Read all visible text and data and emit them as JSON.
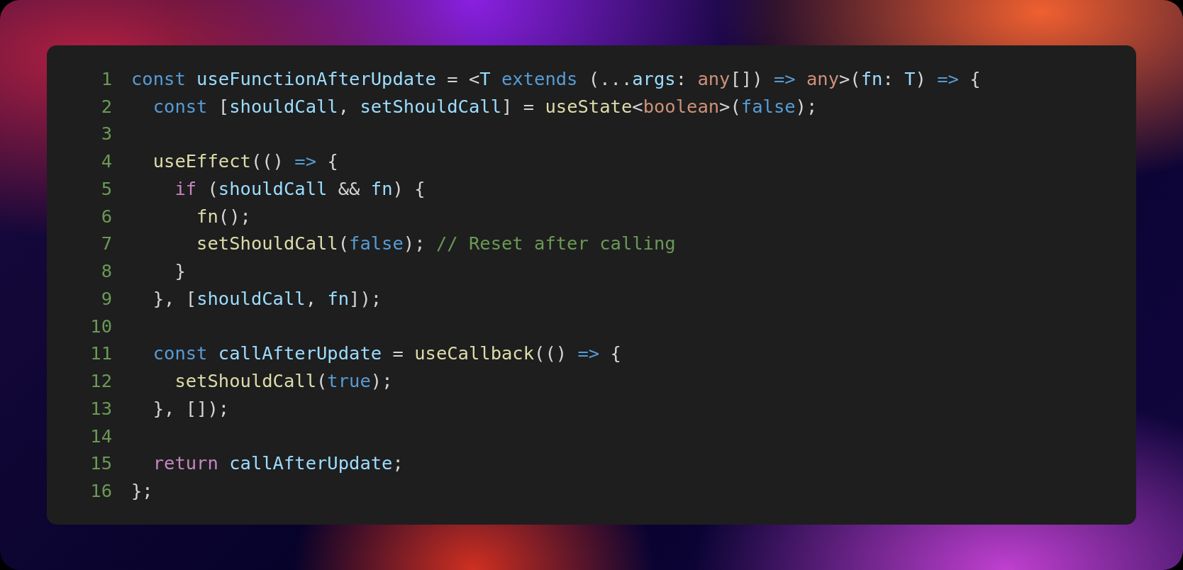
{
  "code_window": {
    "lines": [
      {
        "number": "1",
        "tokens": [
          {
            "text": "const",
            "kind": "keyword"
          },
          {
            "text": " useFunctionAfterUpdate",
            "kind": "variable"
          },
          {
            "text": " = <",
            "kind": "plain"
          },
          {
            "text": "T",
            "kind": "variable"
          },
          {
            "text": " extends",
            "kind": "keyword"
          },
          {
            "text": " (...",
            "kind": "plain"
          },
          {
            "text": "args",
            "kind": "variable"
          },
          {
            "text": ": ",
            "kind": "plain"
          },
          {
            "text": "any",
            "kind": "type"
          },
          {
            "text": "[]) ",
            "kind": "plain"
          },
          {
            "text": "=>",
            "kind": "keyword"
          },
          {
            "text": " any",
            "kind": "type"
          },
          {
            "text": ">(",
            "kind": "plain"
          },
          {
            "text": "fn",
            "kind": "variable"
          },
          {
            "text": ": ",
            "kind": "plain"
          },
          {
            "text": "T",
            "kind": "variable"
          },
          {
            "text": ") ",
            "kind": "plain"
          },
          {
            "text": "=>",
            "kind": "keyword"
          },
          {
            "text": " {",
            "kind": "plain"
          }
        ]
      },
      {
        "number": "2",
        "tokens": [
          {
            "text": "  const",
            "kind": "keyword"
          },
          {
            "text": " [",
            "kind": "plain"
          },
          {
            "text": "shouldCall",
            "kind": "variable"
          },
          {
            "text": ", ",
            "kind": "plain"
          },
          {
            "text": "setShouldCall",
            "kind": "variable"
          },
          {
            "text": "] = ",
            "kind": "plain"
          },
          {
            "text": "useState",
            "kind": "function"
          },
          {
            "text": "<",
            "kind": "plain"
          },
          {
            "text": "boolean",
            "kind": "type"
          },
          {
            "text": ">(",
            "kind": "plain"
          },
          {
            "text": "false",
            "kind": "keyword"
          },
          {
            "text": ");",
            "kind": "plain"
          }
        ]
      },
      {
        "number": "3"
      },
      {
        "number": "4",
        "tokens": [
          {
            "text": "  useEffect",
            "kind": "function"
          },
          {
            "text": "(() ",
            "kind": "plain"
          },
          {
            "text": "=>",
            "kind": "keyword"
          },
          {
            "text": " {",
            "kind": "plain"
          }
        ]
      },
      {
        "number": "5",
        "tokens": [
          {
            "text": "    if",
            "kind": "control"
          },
          {
            "text": " (",
            "kind": "plain"
          },
          {
            "text": "shouldCall",
            "kind": "variable"
          },
          {
            "text": " && ",
            "kind": "plain"
          },
          {
            "text": "fn",
            "kind": "variable"
          },
          {
            "text": ") {",
            "kind": "plain"
          }
        ]
      },
      {
        "number": "6",
        "tokens": [
          {
            "text": "      fn",
            "kind": "function"
          },
          {
            "text": "();",
            "kind": "plain"
          }
        ]
      },
      {
        "number": "7",
        "tokens": [
          {
            "text": "      setShouldCall",
            "kind": "function"
          },
          {
            "text": "(",
            "kind": "plain"
          },
          {
            "text": "false",
            "kind": "keyword"
          },
          {
            "text": "); ",
            "kind": "plain"
          },
          {
            "text": "// Reset after calling",
            "kind": "comment"
          }
        ]
      },
      {
        "number": "8",
        "tokens": [
          {
            "text": "    }",
            "kind": "plain"
          }
        ]
      },
      {
        "number": "9",
        "tokens": [
          {
            "text": "  }, [",
            "kind": "plain"
          },
          {
            "text": "shouldCall",
            "kind": "variable"
          },
          {
            "text": ", ",
            "kind": "plain"
          },
          {
            "text": "fn",
            "kind": "variable"
          },
          {
            "text": "]);",
            "kind": "plain"
          }
        ]
      },
      {
        "number": "10"
      },
      {
        "number": "11",
        "tokens": [
          {
            "text": "  const",
            "kind": "keyword"
          },
          {
            "text": " callAfterUpdate",
            "kind": "variable"
          },
          {
            "text": " = ",
            "kind": "plain"
          },
          {
            "text": "useCallback",
            "kind": "function"
          },
          {
            "text": "(() ",
            "kind": "plain"
          },
          {
            "text": "=>",
            "kind": "keyword"
          },
          {
            "text": " {",
            "kind": "plain"
          }
        ]
      },
      {
        "number": "12",
        "tokens": [
          {
            "text": "    setShouldCall",
            "kind": "function"
          },
          {
            "text": "(",
            "kind": "plain"
          },
          {
            "text": "true",
            "kind": "keyword"
          },
          {
            "text": ");",
            "kind": "plain"
          }
        ]
      },
      {
        "number": "13",
        "tokens": [
          {
            "text": "  }, []);",
            "kind": "plain"
          }
        ]
      },
      {
        "number": "14"
      },
      {
        "number": "15",
        "tokens": [
          {
            "text": "  return",
            "kind": "control"
          },
          {
            "text": " callAfterUpdate",
            "kind": "variable"
          },
          {
            "text": ";",
            "kind": "plain"
          }
        ]
      },
      {
        "number": "16",
        "tokens": [
          {
            "text": "};",
            "kind": "plain"
          }
        ]
      }
    ]
  }
}
